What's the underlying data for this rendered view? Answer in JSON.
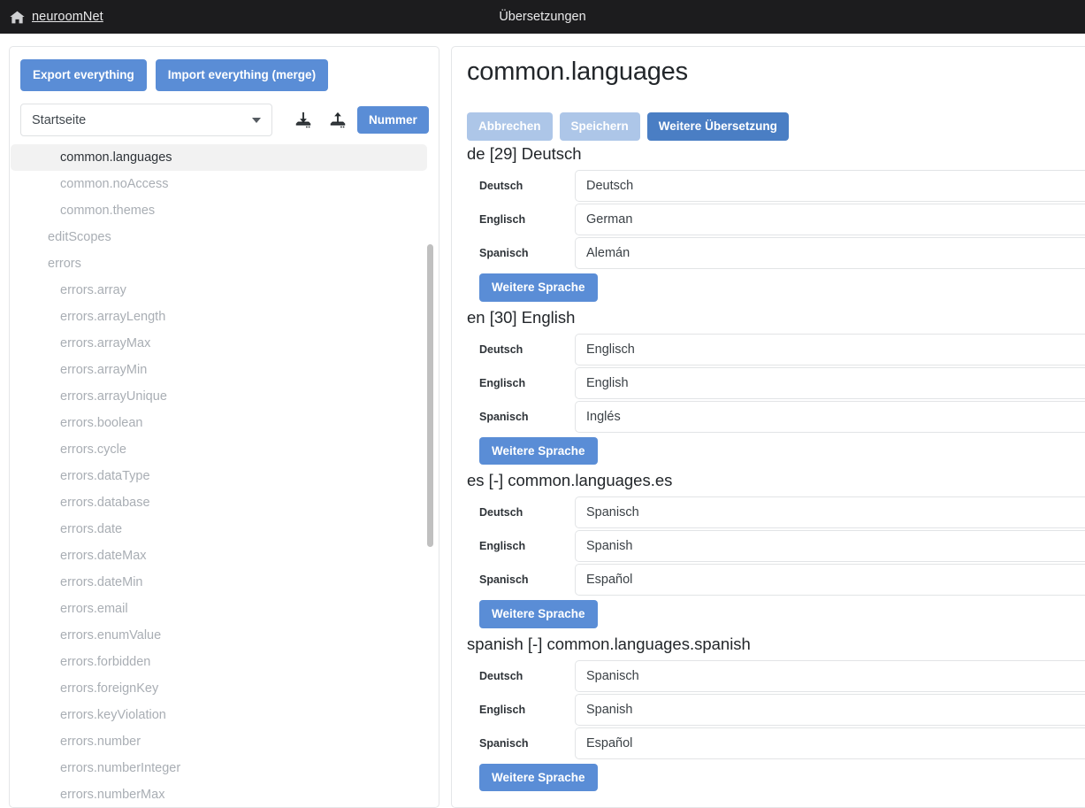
{
  "navbar": {
    "brand": "neuroomNet",
    "brand_icon": "home-icon",
    "title": "Übersetzungen",
    "background": "#1c1c1e"
  },
  "theme": {
    "primary": "#5a8dd6",
    "primary_dark": "#4a7ec4",
    "disabled": "#adc6e8",
    "selected_row": "#f2f2f2"
  },
  "left_panel": {
    "export_button": "Export everything",
    "import_button": "Import everything (merge)",
    "scope_select": {
      "value": "Startseite",
      "caret_icon": "chevron-down-icon"
    },
    "download_icon": "file-download-icon",
    "upload_icon": "file-upload-icon",
    "number_button": "Nummer",
    "keys": [
      {
        "label": "common.languages",
        "level": 1,
        "selected": true
      },
      {
        "label": "common.noAccess",
        "level": 1,
        "selected": false
      },
      {
        "label": "common.themes",
        "level": 1,
        "selected": false
      },
      {
        "label": "editScopes",
        "level": 0,
        "selected": false
      },
      {
        "label": "errors",
        "level": 0,
        "selected": false
      },
      {
        "label": "errors.array",
        "level": 1,
        "selected": false
      },
      {
        "label": "errors.arrayLength",
        "level": 1,
        "selected": false
      },
      {
        "label": "errors.arrayMax",
        "level": 1,
        "selected": false
      },
      {
        "label": "errors.arrayMin",
        "level": 1,
        "selected": false
      },
      {
        "label": "errors.arrayUnique",
        "level": 1,
        "selected": false
      },
      {
        "label": "errors.boolean",
        "level": 1,
        "selected": false
      },
      {
        "label": "errors.cycle",
        "level": 1,
        "selected": false
      },
      {
        "label": "errors.dataType",
        "level": 1,
        "selected": false
      },
      {
        "label": "errors.database",
        "level": 1,
        "selected": false
      },
      {
        "label": "errors.date",
        "level": 1,
        "selected": false
      },
      {
        "label": "errors.dateMax",
        "level": 1,
        "selected": false
      },
      {
        "label": "errors.dateMin",
        "level": 1,
        "selected": false
      },
      {
        "label": "errors.email",
        "level": 1,
        "selected": false
      },
      {
        "label": "errors.enumValue",
        "level": 1,
        "selected": false
      },
      {
        "label": "errors.forbidden",
        "level": 1,
        "selected": false
      },
      {
        "label": "errors.foreignKey",
        "level": 1,
        "selected": false
      },
      {
        "label": "errors.keyViolation",
        "level": 1,
        "selected": false
      },
      {
        "label": "errors.number",
        "level": 1,
        "selected": false
      },
      {
        "label": "errors.numberInteger",
        "level": 1,
        "selected": false
      },
      {
        "label": "errors.numberMax",
        "level": 1,
        "selected": false
      }
    ]
  },
  "detail_panel": {
    "title": "common.languages",
    "actions": {
      "cancel": "Abbrechen",
      "save": "Speichern",
      "add_translation": "Weitere Übersetzung"
    },
    "add_language_label": "Weitere Sprache",
    "sections": [
      {
        "heading": "de [29] Deutsch",
        "fields": [
          {
            "label": "Deutsch",
            "value": "Deutsch"
          },
          {
            "label": "Englisch",
            "value": "German"
          },
          {
            "label": "Spanisch",
            "value": "Alemán"
          }
        ]
      },
      {
        "heading": "en [30] English",
        "fields": [
          {
            "label": "Deutsch",
            "value": "Englisch"
          },
          {
            "label": "Englisch",
            "value": "English"
          },
          {
            "label": "Spanisch",
            "value": "Inglés"
          }
        ]
      },
      {
        "heading": "es [-] common.languages.es",
        "fields": [
          {
            "label": "Deutsch",
            "value": "Spanisch"
          },
          {
            "label": "Englisch",
            "value": "Spanish"
          },
          {
            "label": "Spanisch",
            "value": "Español"
          }
        ]
      },
      {
        "heading": "spanish [-] common.languages.spanish",
        "fields": [
          {
            "label": "Deutsch",
            "value": "Spanisch"
          },
          {
            "label": "Englisch",
            "value": "Spanish"
          },
          {
            "label": "Spanisch",
            "value": "Español"
          }
        ]
      }
    ]
  }
}
